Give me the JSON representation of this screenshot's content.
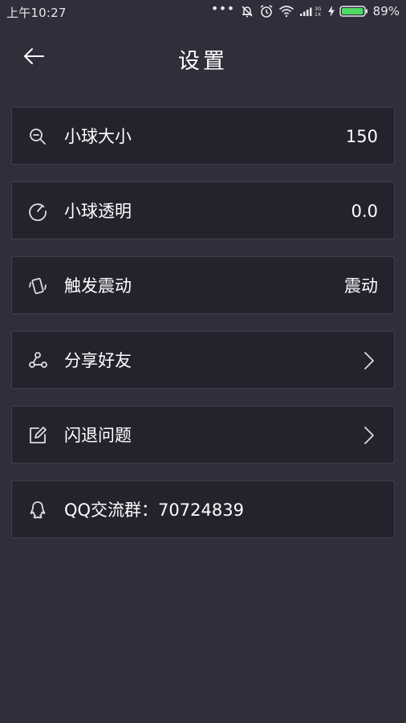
{
  "status_bar": {
    "time": "上午10:27",
    "dots": "•••",
    "battery_percent": "89%",
    "icons": [
      "more-dots-icon",
      "notifications-off-icon",
      "alarm-icon",
      "wifi-icon",
      "signal-3g-icon",
      "charging-icon",
      "battery-icon"
    ]
  },
  "header": {
    "back_icon": "back-arrow-icon",
    "title": "设置"
  },
  "settings": [
    {
      "icon": "zoom-out-icon",
      "label": "小球大小",
      "value": "150"
    },
    {
      "icon": "speedometer-icon",
      "label": "小球透明",
      "value": "0.0"
    },
    {
      "icon": "vibrate-icon",
      "label": "触发震动",
      "value": "震动"
    },
    {
      "icon": "share-icon",
      "label": "分享好友",
      "value": "",
      "chevron": "chevron-right-icon"
    },
    {
      "icon": "edit-icon",
      "label": "闪退问题",
      "value": "",
      "chevron": "chevron-right-icon"
    },
    {
      "icon": "qq-icon",
      "label": "QQ交流群：70724839",
      "value": ""
    }
  ],
  "colors": {
    "background": "#2f2e3b",
    "row_background": "#24232d",
    "row_border": "#3f3e4b",
    "text": "#ffffff",
    "icon": "#dcdce2",
    "battery_fill": "#4cd964"
  }
}
